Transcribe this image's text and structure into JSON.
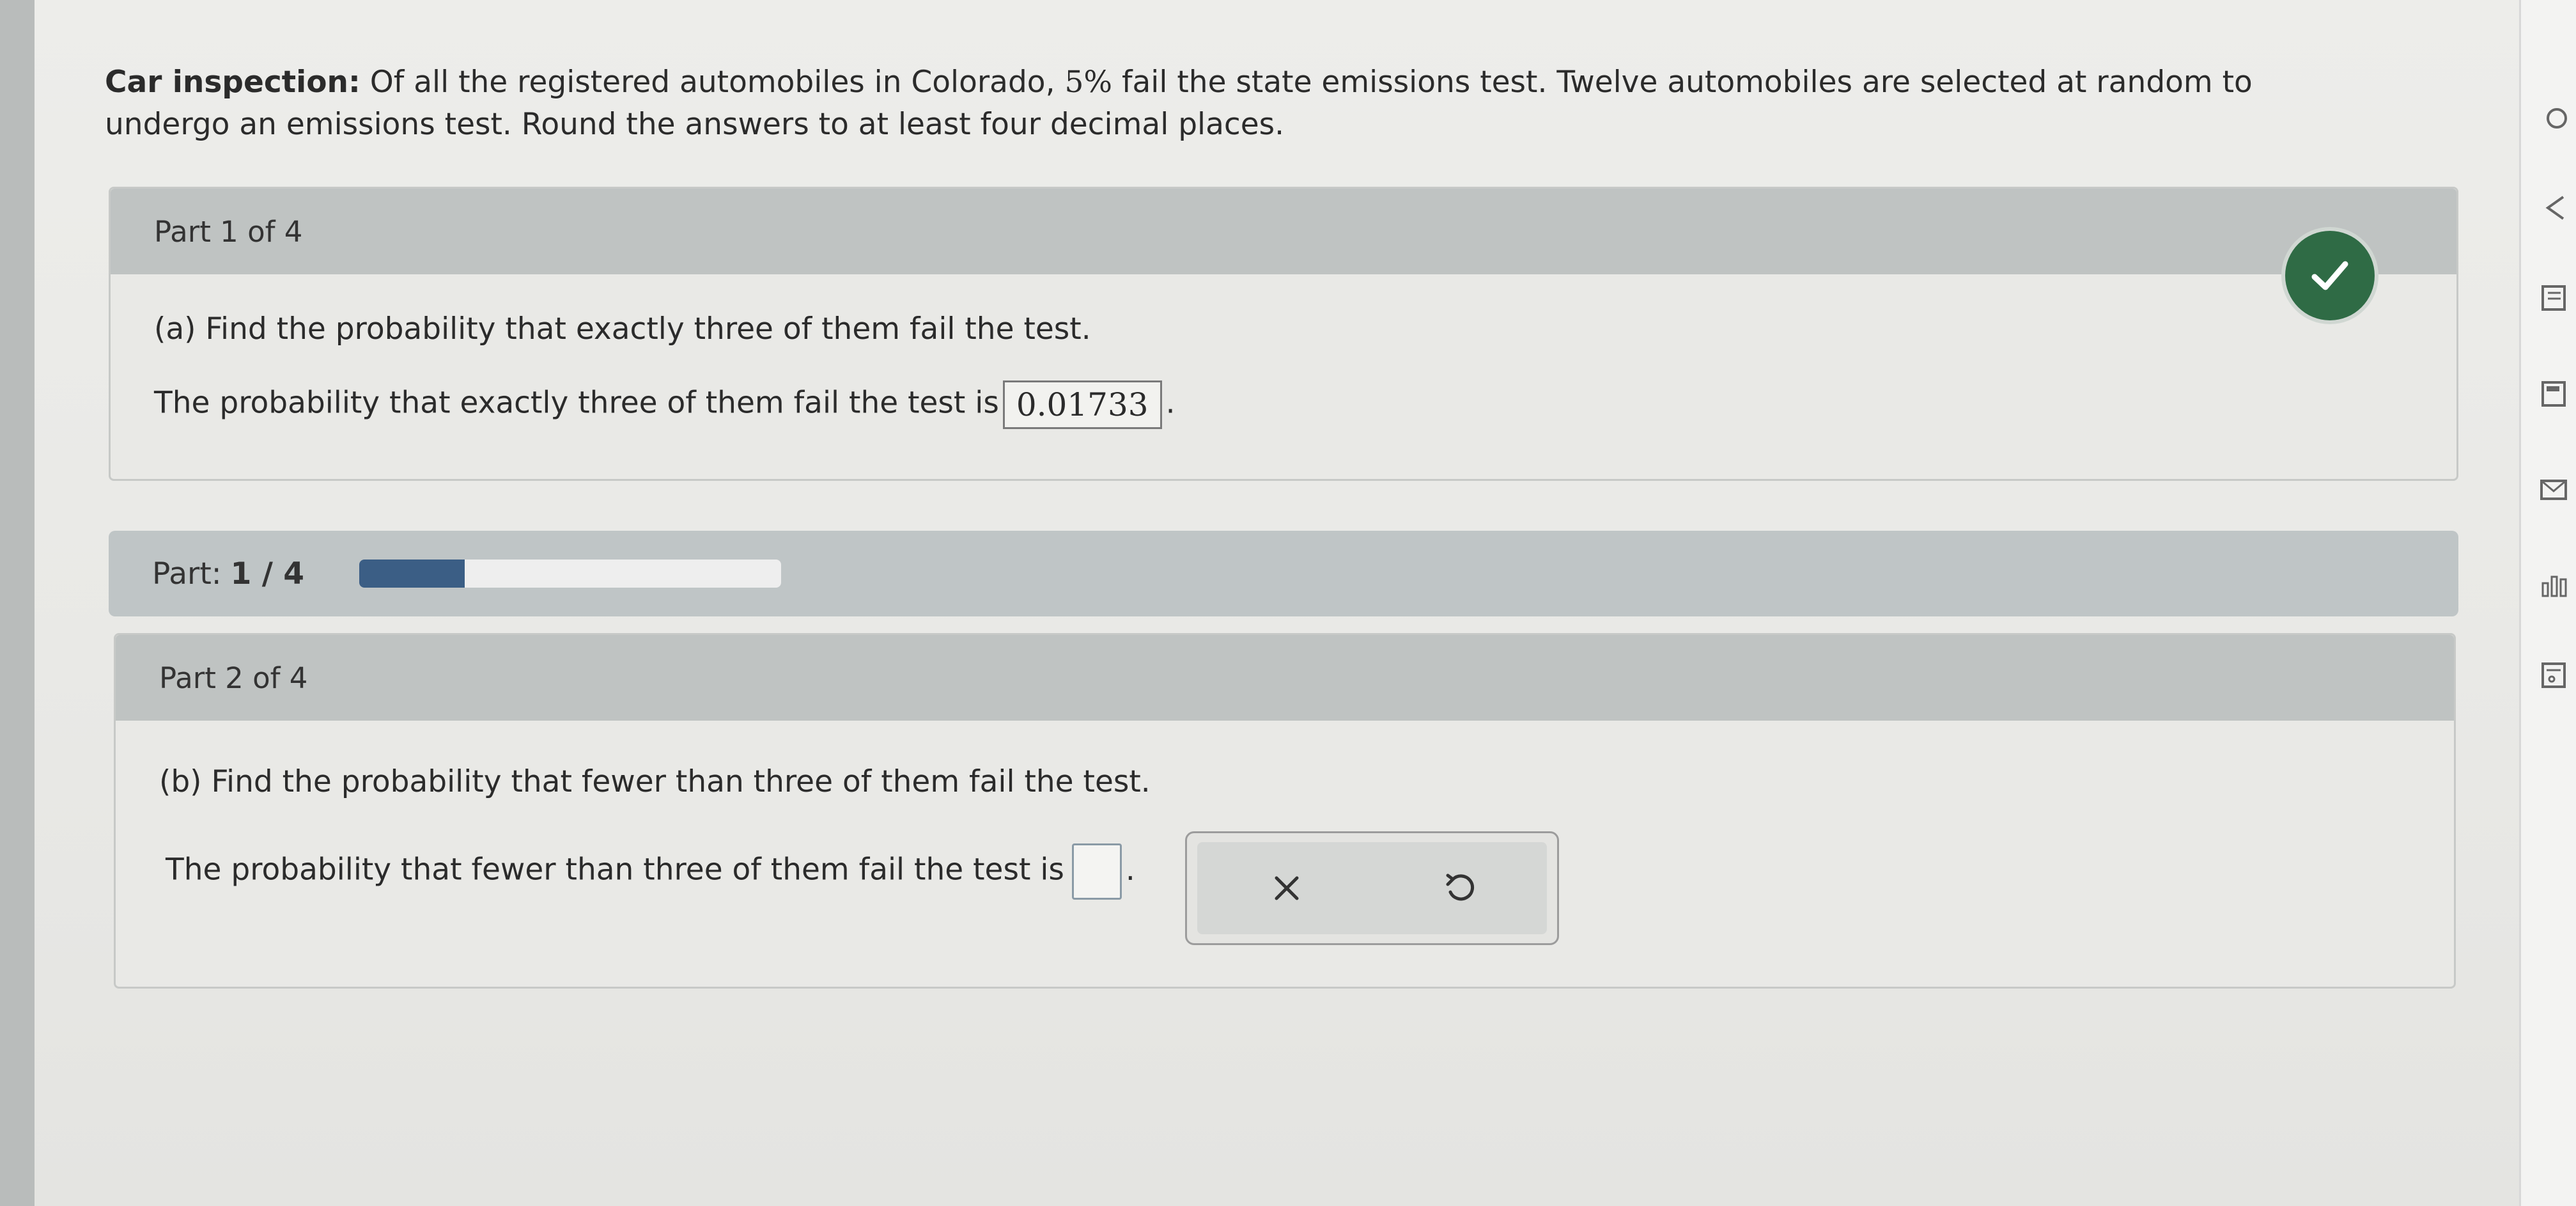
{
  "problem": {
    "title": "Car inspection:",
    "text_before": " Of all the registered automobiles in Colorado, ",
    "percent": "5%",
    "text_after": " fail the state emissions test. Twelve automobiles are selected at random to undergo an emissions test. Round the answers to at least four decimal places."
  },
  "part1": {
    "header": "Part 1 of 4",
    "question": "(a) Find the probability that exactly three of them fail the test.",
    "answer_prefix": "The probability that exactly three of them fail the test is",
    "answer_value": "0.01733",
    "answer_suffix": ".",
    "status": "correct"
  },
  "progress": {
    "label": "Part:",
    "value": "1 / 4",
    "fraction": 0.25
  },
  "part2": {
    "header": "Part 2 of 4",
    "question": "(b) Find the probability that fewer than three of them fail the test.",
    "answer_prefix": "The probability that fewer than three of them fail the test is",
    "answer_value": "",
    "answer_suffix": "."
  },
  "tools": {
    "clear_icon": "close-icon",
    "undo_icon": "undo-icon"
  },
  "colors": {
    "check_green": "#2f6b45",
    "progress_fill": "#3b5e85",
    "header_gray": "#bfc3c2"
  }
}
